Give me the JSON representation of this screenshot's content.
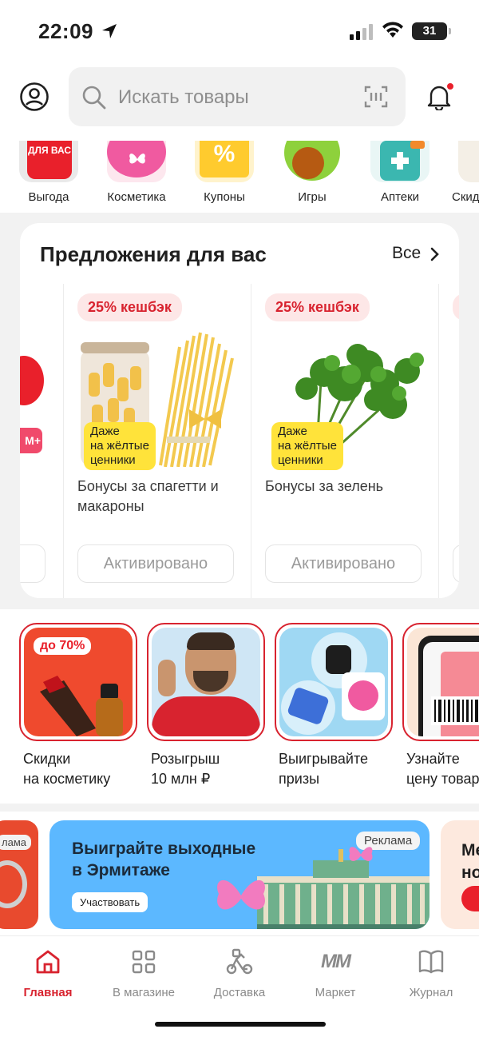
{
  "status_bar": {
    "time": "22:09",
    "battery": "31"
  },
  "search": {
    "placeholder": "Искать товары"
  },
  "categories": [
    {
      "label": "Выгода",
      "badge": "ДЛЯ ВАС"
    },
    {
      "label": "Косметика"
    },
    {
      "label": "Купоны"
    },
    {
      "label": "Игры"
    },
    {
      "label": "Аптеки"
    },
    {
      "label": "Скид"
    }
  ],
  "offers": {
    "title": "Предложения для вас",
    "all_label": "Все",
    "items": [
      {
        "badge": "25% кешбэк",
        "sticker": [
          "Даже",
          "на жёлтые",
          "ценники"
        ],
        "description": "Бонусы за спагетти и макароны",
        "button": "Активировано"
      },
      {
        "badge": "25% кешбэк",
        "sticker": [
          "Даже",
          "на жёлтые",
          "ценники"
        ],
        "description": "Бонусы за зелень",
        "button": "Активировано"
      }
    ]
  },
  "stories": [
    {
      "caption_1": "Скидки",
      "caption_2": "на косметику",
      "tag": "до 70%"
    },
    {
      "caption_1": "Розыгрыш",
      "caption_2": "10 млн ₽"
    },
    {
      "caption_1": "Выигрывайте",
      "caption_2": "призы"
    },
    {
      "caption_1": "Узнайте",
      "caption_2": "цену товар"
    }
  ],
  "banners": {
    "left_ad": "лама",
    "main": {
      "title_1": "Выиграйте выходные",
      "title_2": "в Эрмитаже",
      "cta": "Участвовать",
      "ad_label": "Реклама"
    },
    "right_title_1": "Ме",
    "right_title_2": "но"
  },
  "tabs": [
    {
      "label": "Главная",
      "icon": "home-icon",
      "active": true
    },
    {
      "label": "В магазине",
      "icon": "grid-icon"
    },
    {
      "label": "Доставка",
      "icon": "scooter-icon"
    },
    {
      "label": "Маркет",
      "icon": "market-logo-icon",
      "logo_text": "ММ"
    },
    {
      "label": "Журнал",
      "icon": "book-icon"
    }
  ],
  "colors": {
    "accent": "#d8232f",
    "search_bg": "#f1f1f1",
    "banner_blue": "#5cb8ff",
    "sticker_yellow": "#ffe33a"
  }
}
